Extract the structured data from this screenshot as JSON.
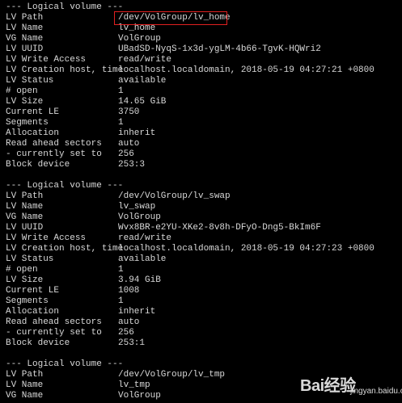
{
  "terminal": {
    "lines": [
      {
        "type": "header",
        "text": "--- Logical volume ---"
      },
      {
        "key": "LV Path",
        "value": "/dev/VolGroup/lv_home"
      },
      {
        "key": "LV Name",
        "value": "lv_home"
      },
      {
        "key": "VG Name",
        "value": "VolGroup"
      },
      {
        "key": "LV UUID",
        "value": "UBadSD-NyqS-1x3d-ygLM-4b66-TgvK-HQWri2"
      },
      {
        "key": "LV Write Access",
        "value": "read/write"
      },
      {
        "key": "LV Creation host, time",
        "value": "localhost.localdomain, 2018-05-19 04:27:21 +0800"
      },
      {
        "key": "LV Status",
        "value": "available"
      },
      {
        "key": "# open",
        "value": "1"
      },
      {
        "key": "LV Size",
        "value": "14.65 GiB"
      },
      {
        "key": "Current LE",
        "value": "3750"
      },
      {
        "key": "Segments",
        "value": "1"
      },
      {
        "key": "Allocation",
        "value": "inherit"
      },
      {
        "key": "Read ahead sectors",
        "value": "auto"
      },
      {
        "key": "- currently set to",
        "value": "256"
      },
      {
        "key": "Block device",
        "value": "253:3"
      },
      {
        "type": "blank"
      },
      {
        "type": "header",
        "text": "--- Logical volume ---"
      },
      {
        "key": "LV Path",
        "value": "/dev/VolGroup/lv_swap"
      },
      {
        "key": "LV Name",
        "value": "lv_swap"
      },
      {
        "key": "VG Name",
        "value": "VolGroup"
      },
      {
        "key": "LV UUID",
        "value": "Wvx8BR-e2YU-XKe2-8v8h-DFyO-Dng5-BkIm6F"
      },
      {
        "key": "LV Write Access",
        "value": "read/write"
      },
      {
        "key": "LV Creation host, time",
        "value": "localhost.localdomain, 2018-05-19 04:27:23 +0800"
      },
      {
        "key": "LV Status",
        "value": "available"
      },
      {
        "key": "# open",
        "value": "1"
      },
      {
        "key": "LV Size",
        "value": "3.94 GiB"
      },
      {
        "key": "Current LE",
        "value": "1008"
      },
      {
        "key": "Segments",
        "value": "1"
      },
      {
        "key": "Allocation",
        "value": "inherit"
      },
      {
        "key": "Read ahead sectors",
        "value": "auto"
      },
      {
        "key": "- currently set to",
        "value": "256"
      },
      {
        "key": "Block device",
        "value": "253:1"
      },
      {
        "type": "blank"
      },
      {
        "type": "header",
        "text": "--- Logical volume ---"
      },
      {
        "key": "LV Path",
        "value": "/dev/VolGroup/lv_tmp"
      },
      {
        "key": "LV Name",
        "value": "lv_tmp"
      },
      {
        "key": "VG Name",
        "value": "VolGroup"
      }
    ]
  },
  "colors": {
    "background": "#000000",
    "text": "#d9d9d9",
    "highlight": "#e02020"
  },
  "watermark": {
    "text": "Bai经验",
    "subtext": "jingyan.baidu.com"
  }
}
